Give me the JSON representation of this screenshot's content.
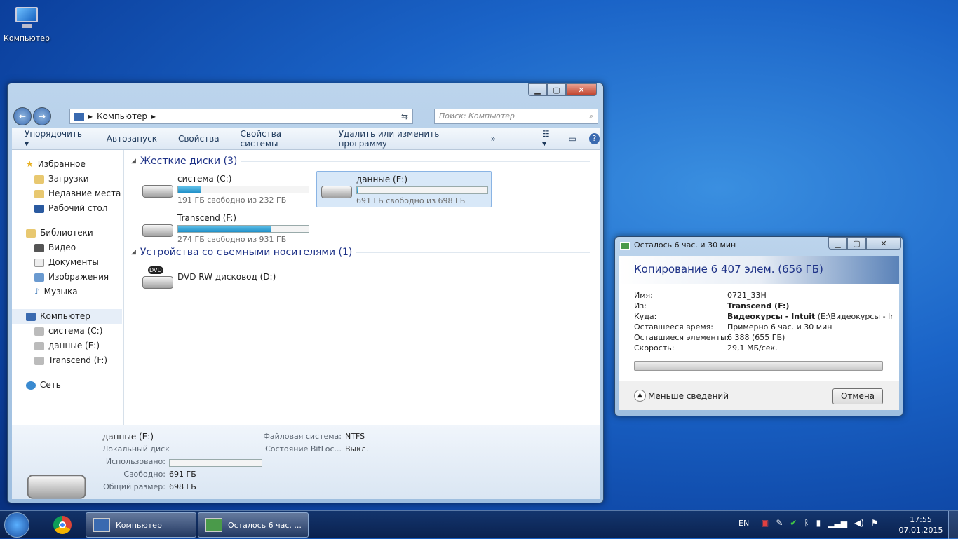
{
  "desktop": {
    "icon_label": "Компьютер"
  },
  "explorer": {
    "address": "Компьютер",
    "search_placeholder": "Поиск: Компьютер",
    "toolbar": [
      "Упорядочить ▾",
      "Автозапуск",
      "Свойства",
      "Свойства системы",
      "Удалить или изменить программу",
      "»"
    ],
    "nav": {
      "favorites": "Избранное",
      "fav_items": [
        "Загрузки",
        "Недавние места",
        "Рабочий стол"
      ],
      "libraries": "Библиотеки",
      "lib_items": [
        "Видео",
        "Документы",
        "Изображения",
        "Музыка"
      ],
      "computer": "Компьютер",
      "comp_items": [
        "система (C:)",
        "данные (E:)",
        "Transcend (F:)"
      ],
      "network": "Сеть"
    },
    "hard_disks_header": "Жесткие диски (3)",
    "drives": [
      {
        "name": "система (C:)",
        "free": "191 ГБ свободно из 232 ГБ",
        "used_pct": 18
      },
      {
        "name": "данные (E:)",
        "free": "691 ГБ свободно из 698 ГБ",
        "used_pct": 1
      },
      {
        "name": "Transcend (F:)",
        "free": "274 ГБ свободно из 931 ГБ",
        "used_pct": 71
      }
    ],
    "removable_header": "Устройства со съемными носителями (1)",
    "dvd": {
      "name": "DVD RW дисковод (D:)",
      "badge": "DVD"
    },
    "details": {
      "name": "данные (E:)",
      "type": "Локальный диск",
      "used_label": "Использовано:",
      "used_pct": 1,
      "free_label": "Свободно:",
      "free": "691 ГБ",
      "total_label": "Общий размер:",
      "total": "698 ГБ",
      "fs_label": "Файловая система:",
      "fs": "NTFS",
      "bitlocker_label": "Состояние BitLoc...",
      "bitlocker": "Выкл."
    }
  },
  "copy": {
    "title": "Осталось 6 час. и 30 мин",
    "heading": "Копирование 6 407 элем. (656 ГБ)",
    "rows": [
      {
        "k": "Имя:",
        "v": "0721_33H"
      },
      {
        "k": "Из:",
        "v": "Transcend (F:)"
      },
      {
        "k": "Куда:",
        "v": "Видеокурсы - Intuit",
        "extra": " (E:\\Видеокурсы - Ir"
      },
      {
        "k": "Оставшееся время:",
        "v": "Примерно 6 час. и 30 мин"
      },
      {
        "k": "Оставшиеся элементы:",
        "v": "6 388 (655 ГБ)"
      },
      {
        "k": "Скорость:",
        "v": "29,1 МБ/сек."
      }
    ],
    "progress_pct": 0,
    "less_details": "Меньше сведений",
    "cancel": "Отмена"
  },
  "taskbar": {
    "items": [
      "Компьютер",
      "Осталось 6 час. ..."
    ],
    "lang": "EN",
    "time": "17:55",
    "date": "07.01.2015"
  }
}
